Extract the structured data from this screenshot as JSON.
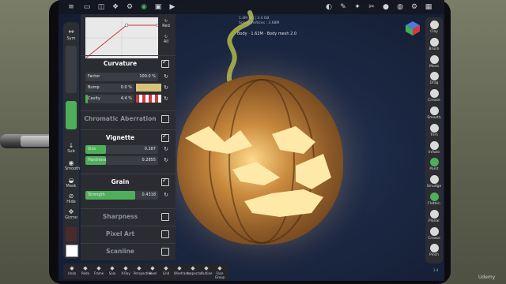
{
  "curve": {
    "labels": [
      "Red",
      "All"
    ]
  },
  "left_toolbar": {
    "items": [
      {
        "label": "Sym"
      },
      {
        "label": "Sub"
      },
      {
        "label": "Smooth"
      },
      {
        "label": "Mask"
      },
      {
        "label": "Hide"
      },
      {
        "label": "Gizmo"
      }
    ]
  },
  "panel": {
    "curvature": {
      "title": "Curvature",
      "enabled": true,
      "rows": [
        {
          "label": "Factor",
          "value": "100.0 %"
        },
        {
          "label": "Bump",
          "value": "0.0 %"
        },
        {
          "label": "Cavity",
          "value": "4.4 %"
        }
      ]
    },
    "chromatic": {
      "title": "Chromatic Aberration",
      "enabled": false
    },
    "vignette": {
      "title": "Vignette",
      "enabled": true,
      "rows": [
        {
          "label": "Size",
          "value": "0.287",
          "fraction": 0.287
        },
        {
          "label": "Hardness",
          "value": "0.2855",
          "fraction": 0.2855
        }
      ]
    },
    "grain": {
      "title": "Grain",
      "enabled": true,
      "rows": [
        {
          "label": "Strength",
          "value": "0.4318",
          "fraction": 0.68
        }
      ]
    },
    "sharpness": {
      "title": "Sharpness",
      "enabled": false
    },
    "pixelart": {
      "title": "Pixel Art",
      "enabled": false
    },
    "scanline": {
      "title": "Scanline",
      "enabled": false
    }
  },
  "scene_info": {
    "line1": "1.4M SD | 3.4 GB",
    "line2": "Scene vertices : 3.68M",
    "body_label": "Body · 1.62M · Body mesh 2.0"
  },
  "right_toolbar": {
    "items": [
      {
        "label": "Clay"
      },
      {
        "label": "Brush"
      },
      {
        "label": "Move"
      },
      {
        "label": "Drag"
      },
      {
        "label": "Crease"
      },
      {
        "label": "Smooth"
      },
      {
        "label": "Trim"
      },
      {
        "label": "Inflate"
      },
      {
        "label": "Paint"
      },
      {
        "label": "Smudge"
      },
      {
        "label": "Flatten"
      },
      {
        "label": "Planar"
      },
      {
        "label": "Crease"
      },
      {
        "label": "Pinch"
      }
    ]
  },
  "bottom_toolbar": {
    "items": [
      {
        "label": "Undo"
      },
      {
        "label": "Redo"
      },
      {
        "label": "Frame"
      },
      {
        "label": "Solo"
      },
      {
        "label": "X-Ray"
      },
      {
        "label": "Perspective"
      },
      {
        "label": "Voxel"
      },
      {
        "label": "Grid"
      },
      {
        "label": "Wireframe"
      },
      {
        "label": "Inspector"
      },
      {
        "label": "Outline"
      },
      {
        "label": "Face Group"
      }
    ]
  },
  "page_num": "3.4",
  "watermark": "Udemy",
  "colors": {
    "accent_green": "#4fae5a",
    "panel_bg": "#2a2c32"
  }
}
